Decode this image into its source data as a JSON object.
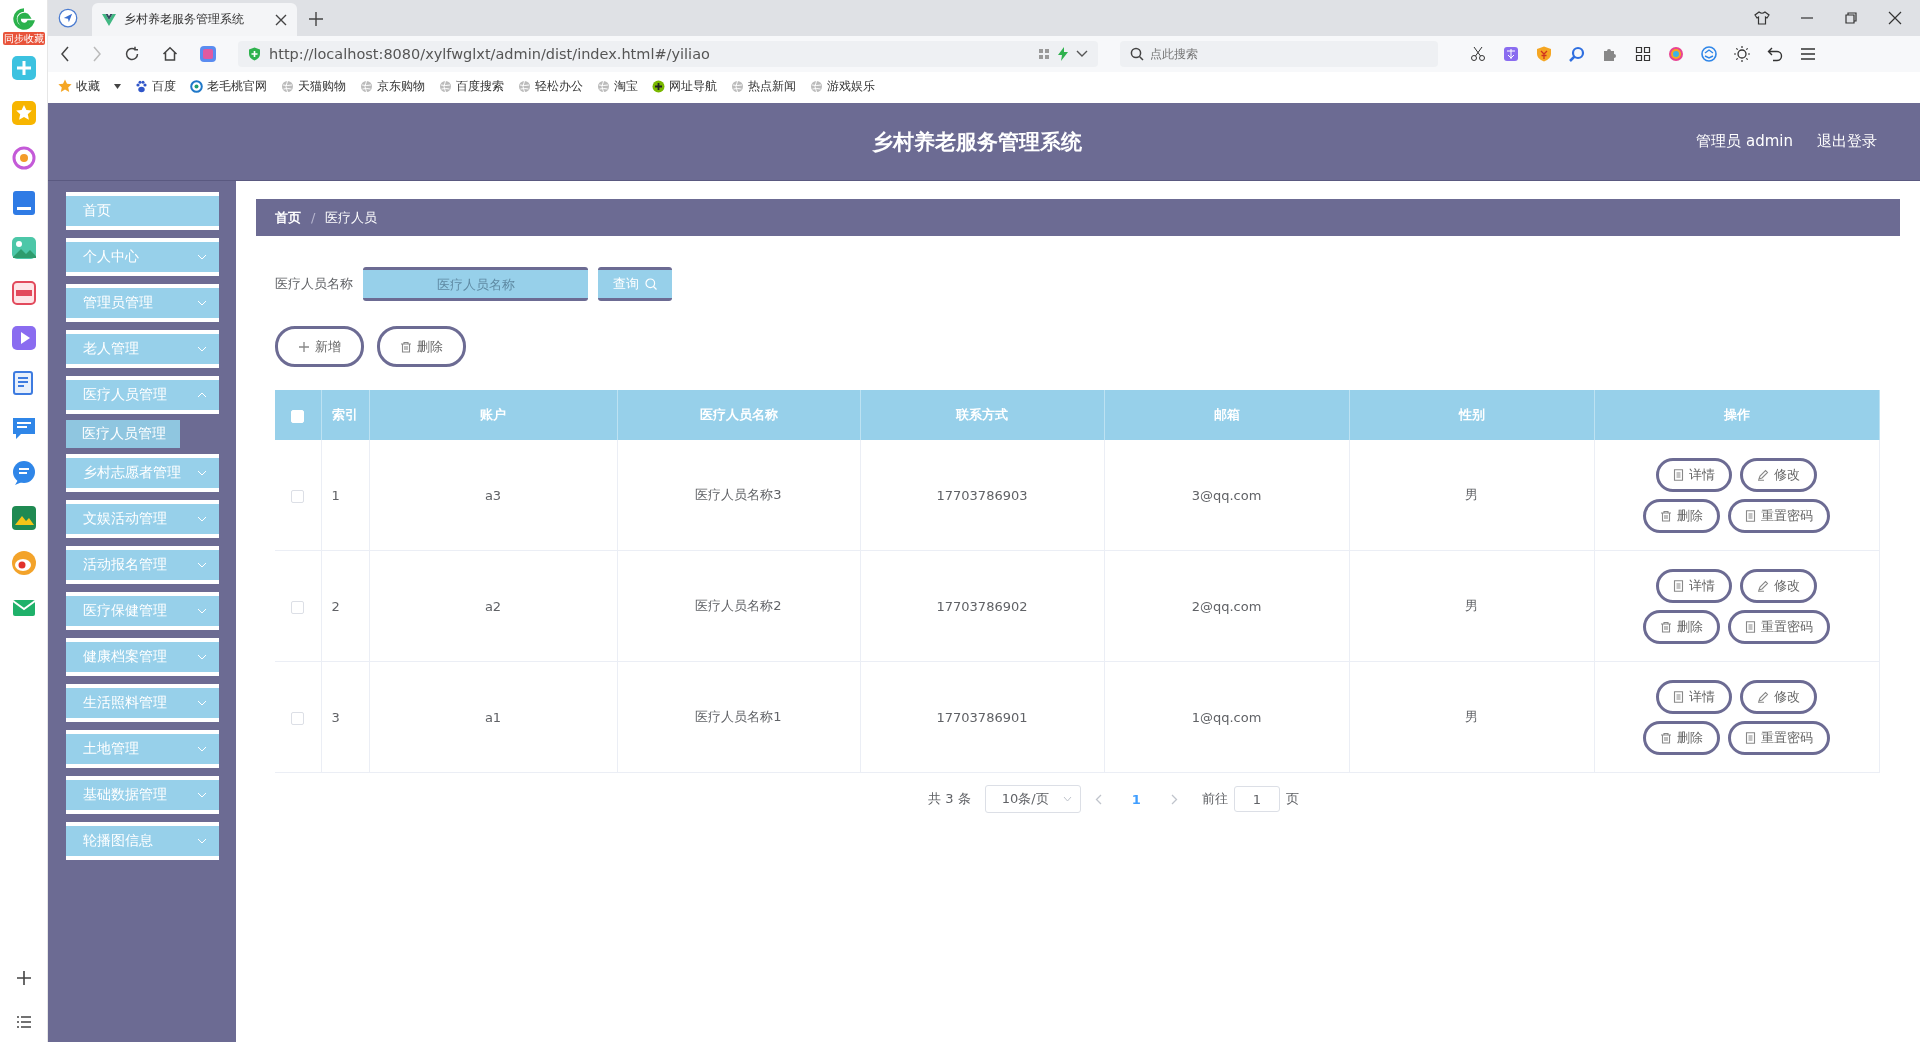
{
  "browser": {
    "sync_label": "同步收藏",
    "tab_title": "乡村养老服务管理系统",
    "url": "http://localhost:8080/xylfwglxt/admin/dist/index.html#/yiliao",
    "search_placeholder": "点此搜索",
    "bookmarks": [
      {
        "label": "收藏",
        "kind": "star"
      },
      {
        "label": "百度",
        "kind": "paw"
      },
      {
        "label": "老毛桃官网",
        "kind": "ring"
      },
      {
        "label": "天猫购物",
        "kind": "globe"
      },
      {
        "label": "京东购物",
        "kind": "globe"
      },
      {
        "label": "百度搜索",
        "kind": "globe"
      },
      {
        "label": "轻松办公",
        "kind": "globe"
      },
      {
        "label": "淘宝",
        "kind": "globe"
      },
      {
        "label": "网址导航",
        "kind": "plus"
      },
      {
        "label": "热点新闻",
        "kind": "globe"
      },
      {
        "label": "游戏娱乐",
        "kind": "globe"
      }
    ]
  },
  "header": {
    "title": "乡村养老服务管理系统",
    "user": "管理员 admin",
    "logout": "退出登录"
  },
  "sidebar": {
    "items": [
      {
        "label": "首页",
        "expandable": false
      },
      {
        "label": "个人中心",
        "expandable": true,
        "expanded": false
      },
      {
        "label": "管理员管理",
        "expandable": true,
        "expanded": false
      },
      {
        "label": "老人管理",
        "expandable": true,
        "expanded": false
      },
      {
        "label": "医疗人员管理",
        "expandable": true,
        "expanded": true,
        "children": [
          {
            "label": "医疗人员管理",
            "selected": true
          }
        ]
      },
      {
        "label": "乡村志愿者管理",
        "expandable": true,
        "expanded": false
      },
      {
        "label": "文娱活动管理",
        "expandable": true,
        "expanded": false
      },
      {
        "label": "活动报名管理",
        "expandable": true,
        "expanded": false
      },
      {
        "label": "医疗保健管理",
        "expandable": true,
        "expanded": false
      },
      {
        "label": "健康档案管理",
        "expandable": true,
        "expanded": false
      },
      {
        "label": "生活照料管理",
        "expandable": true,
        "expanded": false
      },
      {
        "label": "土地管理",
        "expandable": true,
        "expanded": false
      },
      {
        "label": "基础数据管理",
        "expandable": true,
        "expanded": false
      },
      {
        "label": "轮播图信息",
        "expandable": true,
        "expanded": false
      }
    ]
  },
  "breadcrumb": {
    "items": [
      "首页",
      "医疗人员"
    ],
    "separator": "/"
  },
  "search": {
    "label": "医疗人员名称",
    "placeholder": "医疗人员名称",
    "button": "查询"
  },
  "actions": [
    {
      "label": "新增",
      "kind": "plus"
    },
    {
      "label": "删除",
      "kind": "trash"
    }
  ],
  "table": {
    "all_checked": false,
    "columns": [
      "索引",
      "账户",
      "医疗人员名称",
      "联系方式",
      "邮箱",
      "性别",
      "操作"
    ],
    "rows": [
      {
        "checked": false,
        "cells": [
          "1",
          "a3",
          "医疗人员名称3",
          "17703786903",
          "3@qq.com",
          "男"
        ],
        "actions": [
          {
            "label": "详情",
            "kind": "detail"
          },
          {
            "label": "修改",
            "kind": "edit"
          },
          {
            "label": "删除",
            "kind": "delete"
          },
          {
            "label": "重置密码",
            "kind": "reset"
          }
        ]
      },
      {
        "checked": false,
        "cells": [
          "2",
          "a2",
          "医疗人员名称2",
          "17703786902",
          "2@qq.com",
          "男"
        ],
        "actions": [
          {
            "label": "详情",
            "kind": "detail"
          },
          {
            "label": "修改",
            "kind": "edit"
          },
          {
            "label": "删除",
            "kind": "delete"
          },
          {
            "label": "重置密码",
            "kind": "reset"
          }
        ]
      },
      {
        "checked": false,
        "cells": [
          "3",
          "a1",
          "医疗人员名称1",
          "17703786901",
          "1@qq.com",
          "男"
        ],
        "actions": [
          {
            "label": "详情",
            "kind": "detail"
          },
          {
            "label": "修改",
            "kind": "edit"
          },
          {
            "label": "删除",
            "kind": "delete"
          },
          {
            "label": "重置密码",
            "kind": "reset"
          }
        ]
      }
    ]
  },
  "pagination": {
    "total": "共 3 条",
    "page_size": "10条/页",
    "pages": [
      {
        "label": "1",
        "selected": true
      }
    ],
    "goto": "前往",
    "goto_value": "1",
    "unit": "页"
  }
}
